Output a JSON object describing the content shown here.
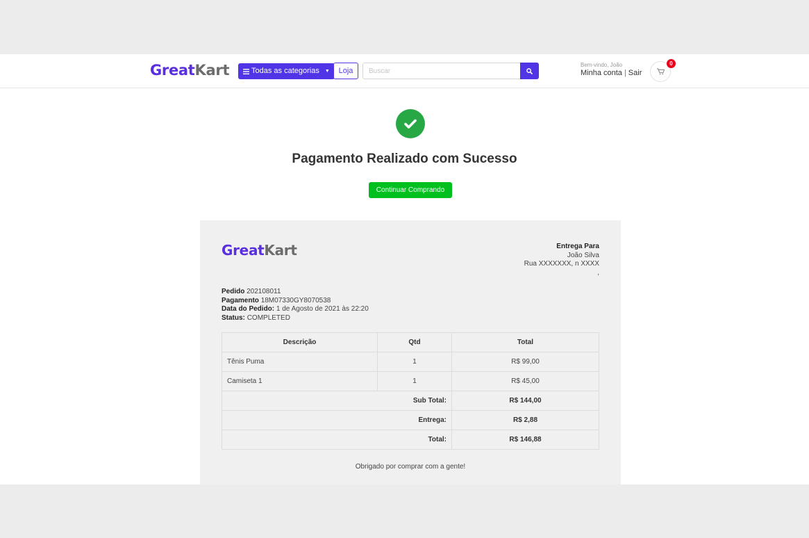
{
  "header": {
    "logo_great": "Great",
    "logo_kart": "Kart",
    "categories_label": "Todas as categorias",
    "shop_label": "Loja",
    "search_placeholder": "Buscar",
    "welcome": "Bem-vindo, João",
    "account_label": "Minha conta",
    "separator": "|",
    "logout_label": "Sair",
    "cart_count": "0"
  },
  "main": {
    "status_icon": "check-circle-icon",
    "success_title": "Pagamento Realizado com Sucesso",
    "continue_label": "Continuar Comprando"
  },
  "invoice": {
    "logo_great": "Great",
    "logo_kart": "Kart",
    "ship_heading": "Entrega Para",
    "ship_name": "João Silva",
    "ship_address": "Rua XXXXXXX, n XXXX",
    "ship_extra": ",",
    "order_label": "Pedido",
    "order_value": "202108011",
    "payment_label": "Pagamento",
    "payment_value": "18M07330GY8070538",
    "date_label": "Data do Pedido:",
    "date_value": "1 de Agosto de 2021 às 22:20",
    "status_label": "Status:",
    "status_value": "COMPLETED",
    "columns": [
      "Descrição",
      "Qtd",
      "Total"
    ],
    "items": [
      {
        "desc": "Tênis Puma",
        "qty": "1",
        "total": "R$ 99,00"
      },
      {
        "desc": "Camiseta 1",
        "qty": "1",
        "total": "R$ 45,00"
      }
    ],
    "subtotal_label": "Sub Total:",
    "subtotal_value": "R$ 144,00",
    "shipping_label": "Entrega:",
    "shipping_value": "R$ 2,88",
    "total_label": "Total:",
    "total_value": "R$ 146,88",
    "thanks": "Obrigado por comprar com a gente!"
  },
  "colors": {
    "brand": "#5a2fe0",
    "primary_button": "#4f35e6",
    "success_icon": "#28a745",
    "continue_button": "#00c020",
    "cart_badge": "#e8001c"
  }
}
